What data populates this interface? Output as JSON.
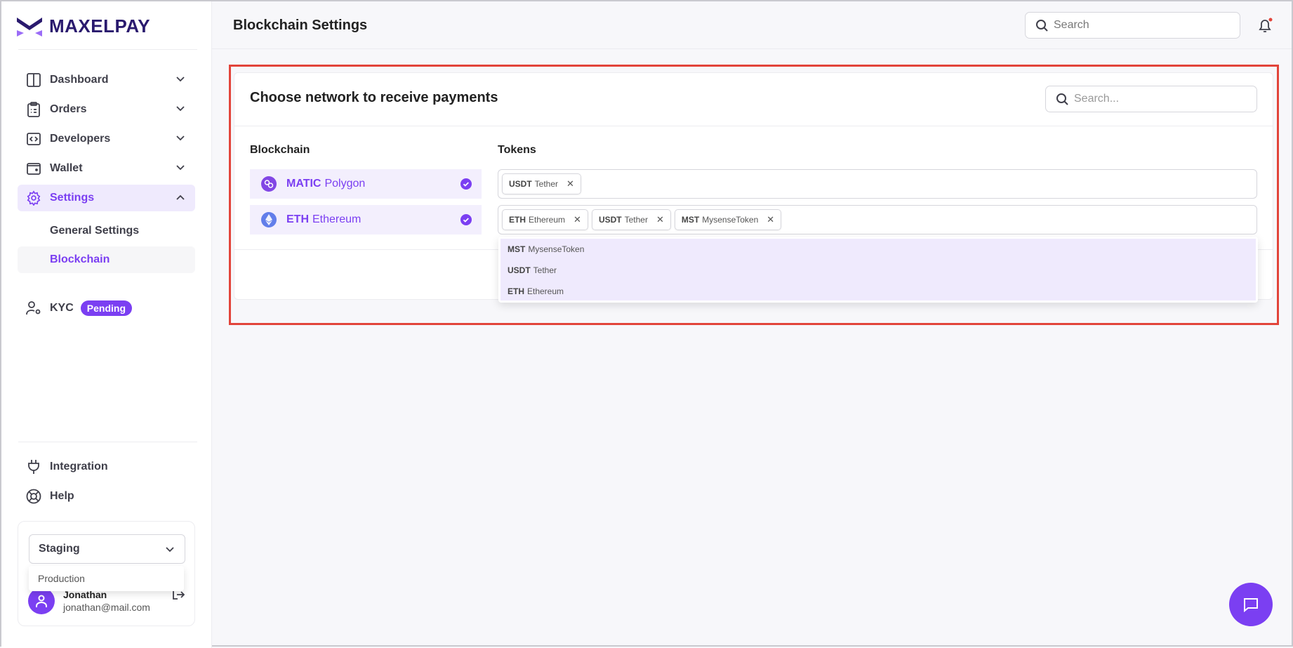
{
  "brand": {
    "name": "MAXELPAY",
    "accent": "#7b3ff2"
  },
  "sidebar": {
    "items": [
      {
        "label": "Dashboard",
        "icon": "layout-icon"
      },
      {
        "label": "Orders",
        "icon": "clipboard-icon"
      },
      {
        "label": "Developers",
        "icon": "code-icon"
      },
      {
        "label": "Wallet",
        "icon": "wallet-icon"
      },
      {
        "label": "Settings",
        "icon": "gear-icon"
      }
    ],
    "settings_sub": [
      "General Settings",
      "Blockchain"
    ],
    "kyc": {
      "label": "KYC",
      "badge": "Pending"
    },
    "bottom": [
      {
        "label": "Integration",
        "icon": "plug-icon"
      },
      {
        "label": "Help",
        "icon": "lifebuoy-icon"
      }
    ],
    "environment": {
      "selected": "Staging",
      "options": [
        "Production"
      ]
    },
    "user": {
      "name": "Jonathan",
      "email": "jonathan@mail.com"
    }
  },
  "header": {
    "title": "Blockchain Settings",
    "search_placeholder": "Search"
  },
  "card": {
    "title": "Choose network to receive payments",
    "search_placeholder": "Search...",
    "col_blockchain": "Blockchain",
    "col_tokens": "Tokens",
    "rows": [
      {
        "symbol": "MATIC",
        "name": "Polygon",
        "checked": true,
        "tokens": [
          {
            "symbol": "USDT",
            "name": "Tether"
          }
        ]
      },
      {
        "symbol": "ETH",
        "name": "Ethereum",
        "checked": true,
        "tokens": [
          {
            "symbol": "ETH",
            "name": "Ethereum"
          },
          {
            "symbol": "USDT",
            "name": "Tether"
          },
          {
            "symbol": "MST",
            "name": "MysenseToken"
          }
        ]
      }
    ],
    "dropdown": [
      {
        "symbol": "MST",
        "name": "MysenseToken"
      },
      {
        "symbol": "USDT",
        "name": "Tether"
      },
      {
        "symbol": "ETH",
        "name": "Ethereum"
      }
    ]
  }
}
